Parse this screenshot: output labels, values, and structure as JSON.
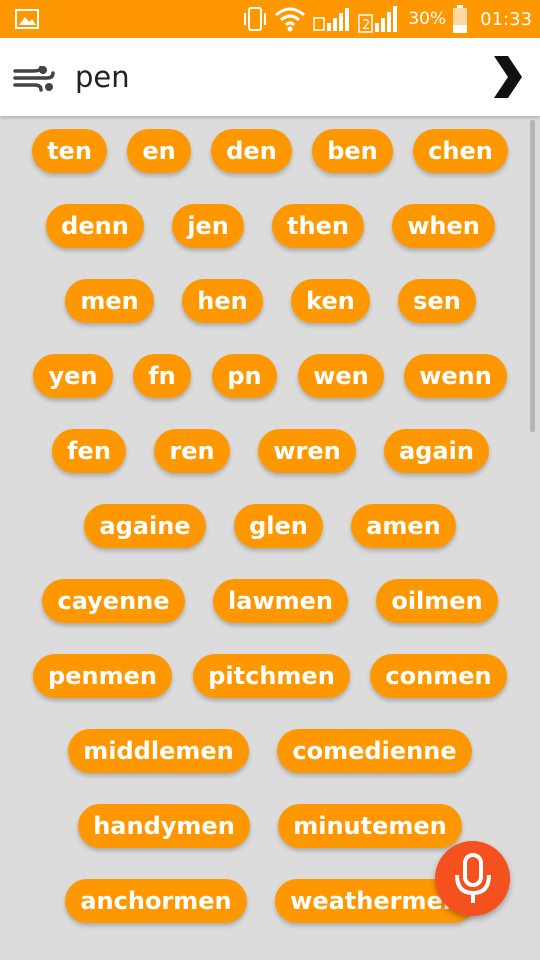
{
  "status_bar": {
    "gallery_icon": "image-icon",
    "battery_percent": "30%",
    "time": "01:33",
    "sim_label": "2"
  },
  "search": {
    "query": "pen",
    "menu_icon": "wind-icon",
    "go_icon": "chevron-right-icon"
  },
  "colors": {
    "accent": "#ff9800",
    "mic": "#f4511e",
    "background": "#dcdcdc"
  },
  "results": [
    [
      "ten",
      "en",
      "den",
      "ben",
      "chen"
    ],
    [
      "denn",
      "jen",
      "then",
      "when"
    ],
    [
      "men",
      "hen",
      "ken",
      "sen"
    ],
    [
      "yen",
      "fn",
      "pn",
      "wen",
      "wenn"
    ],
    [
      "fen",
      "ren",
      "wren",
      "again"
    ],
    [
      "againe",
      "glen",
      "amen"
    ],
    [
      "cayenne",
      "lawmen",
      "oilmen"
    ],
    [
      "penmen",
      "pitchmen",
      "conmen"
    ],
    [
      "middlemen",
      "comedienne"
    ],
    [
      "handymen",
      "minutemen"
    ],
    [
      "anchormen",
      "weathermen"
    ]
  ],
  "mic_button": {
    "icon": "microphone-icon"
  }
}
